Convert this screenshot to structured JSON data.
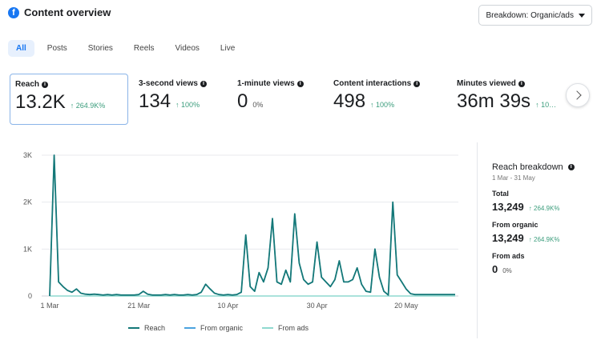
{
  "header": {
    "title": "Content overview",
    "logo_icon": "facebook-icon"
  },
  "breakdown_select": {
    "label": "Breakdown: Organic/ads"
  },
  "tabs": [
    {
      "label": "All",
      "active": true
    },
    {
      "label": "Posts"
    },
    {
      "label": "Stories"
    },
    {
      "label": "Reels"
    },
    {
      "label": "Videos"
    },
    {
      "label": "Live"
    }
  ],
  "metrics": [
    {
      "label": "Reach",
      "value": "13.2K",
      "delta": "↑ 264.9K%"
    },
    {
      "label": "3-second views",
      "value": "134",
      "delta": "↑ 100%"
    },
    {
      "label": "1-minute views",
      "value": "0",
      "delta": "0%"
    },
    {
      "label": "Content interactions",
      "value": "498",
      "delta": "↑ 100%"
    },
    {
      "label": "Minutes viewed",
      "value": "36m 39s",
      "delta": "↑ 10…"
    }
  ],
  "chart_data": {
    "type": "line",
    "x": [
      "1 Mar",
      "2 Mar",
      "3 Mar",
      "4 Mar",
      "5 Mar",
      "6 Mar",
      "7 Mar",
      "8 Mar",
      "9 Mar",
      "10 Mar",
      "11 Mar",
      "12 Mar",
      "13 Mar",
      "14 Mar",
      "15 Mar",
      "16 Mar",
      "17 Mar",
      "18 Mar",
      "19 Mar",
      "20 Mar",
      "21 Mar",
      "22 Mar",
      "23 Mar",
      "24 Mar",
      "25 Mar",
      "26 Mar",
      "27 Mar",
      "28 Mar",
      "29 Mar",
      "30 Mar",
      "31 Mar",
      "1 Apr",
      "2 Apr",
      "3 Apr",
      "4 Apr",
      "5 Apr",
      "6 Apr",
      "7 Apr",
      "8 Apr",
      "9 Apr",
      "10 Apr",
      "11 Apr",
      "12 Apr",
      "13 Apr",
      "14 Apr",
      "15 Apr",
      "16 Apr",
      "17 Apr",
      "18 Apr",
      "19 Apr",
      "20 Apr",
      "21 Apr",
      "22 Apr",
      "23 Apr",
      "24 Apr",
      "25 Apr",
      "26 Apr",
      "27 Apr",
      "28 Apr",
      "29 Apr",
      "30 Apr",
      "1 May",
      "2 May",
      "3 May",
      "4 May",
      "5 May",
      "6 May",
      "7 May",
      "8 May",
      "9 May",
      "10 May",
      "11 May",
      "12 May",
      "13 May",
      "14 May",
      "15 May",
      "16 May",
      "17 May",
      "18 May",
      "19 May",
      "20 May",
      "21 May",
      "22 May",
      "23 May",
      "24 May",
      "25 May",
      "26 May",
      "27 May",
      "28 May",
      "29 May",
      "30 May",
      "31 May"
    ],
    "series": [
      {
        "name": "Reach",
        "values": [
          0,
          3000,
          300,
          200,
          120,
          80,
          150,
          60,
          40,
          30,
          40,
          30,
          20,
          30,
          20,
          30,
          20,
          20,
          20,
          20,
          30,
          100,
          40,
          20,
          20,
          20,
          30,
          20,
          30,
          20,
          20,
          30,
          20,
          30,
          80,
          250,
          150,
          60,
          30,
          20,
          30,
          20,
          30,
          80,
          1300,
          200,
          100,
          500,
          300,
          600,
          1650,
          300,
          250,
          550,
          300,
          1750,
          700,
          350,
          250,
          300,
          1150,
          400,
          300,
          200,
          350,
          750,
          300,
          300,
          350,
          600,
          250,
          100,
          80,
          1000,
          400,
          100,
          20,
          2000,
          450,
          300,
          150,
          50,
          30,
          30,
          30,
          30,
          30,
          30,
          30,
          30,
          30,
          30
        ],
        "color": "#147878"
      },
      {
        "name": "From organic",
        "values": [
          0,
          3000,
          300,
          200,
          120,
          80,
          150,
          60,
          40,
          30,
          40,
          30,
          20,
          30,
          20,
          30,
          20,
          20,
          20,
          20,
          30,
          100,
          40,
          20,
          20,
          20,
          30,
          20,
          30,
          20,
          20,
          30,
          20,
          30,
          80,
          250,
          150,
          60,
          30,
          20,
          30,
          20,
          30,
          80,
          1300,
          200,
          100,
          500,
          300,
          600,
          1650,
          300,
          250,
          550,
          300,
          1750,
          700,
          350,
          250,
          300,
          1150,
          400,
          300,
          200,
          350,
          750,
          300,
          300,
          350,
          600,
          250,
          100,
          80,
          1000,
          400,
          100,
          20,
          2000,
          450,
          300,
          150,
          50,
          30,
          30,
          30,
          30,
          30,
          30,
          30,
          30,
          30,
          30
        ],
        "color": "#4aa3df"
      },
      {
        "name": "From ads",
        "values": [
          0,
          0,
          0,
          0,
          0,
          0,
          0,
          0,
          0,
          0,
          0,
          0,
          0,
          0,
          0,
          0,
          0,
          0,
          0,
          0,
          0,
          0,
          0,
          0,
          0,
          0,
          0,
          0,
          0,
          0,
          0,
          0,
          0,
          0,
          0,
          0,
          0,
          0,
          0,
          0,
          0,
          0,
          0,
          0,
          0,
          0,
          0,
          0,
          0,
          0,
          0,
          0,
          0,
          0,
          0,
          0,
          0,
          0,
          0,
          0,
          0,
          0,
          0,
          0,
          0,
          0,
          0,
          0,
          0,
          0,
          0,
          0,
          0,
          0,
          0,
          0,
          0,
          0,
          0,
          0,
          0,
          0,
          0,
          0,
          0,
          0,
          0,
          0,
          0,
          0,
          0,
          0
        ],
        "color": "#8fd9cf"
      }
    ],
    "xticks": [
      "1 Mar",
      "21 Mar",
      "10 Apr",
      "30 Apr",
      "20 May"
    ],
    "yticks": [
      "0",
      "1K",
      "2K",
      "3K"
    ],
    "ylim": [
      0,
      3000
    ],
    "legend": "bottom",
    "grid": true
  },
  "reach_breakdown": {
    "title": "Reach breakdown",
    "date_range": "1 Mar - 31 May",
    "items": [
      {
        "label": "Total",
        "value": "13,249",
        "delta": "↑ 264.9K%"
      },
      {
        "label": "From organic",
        "value": "13,249",
        "delta": "↑ 264.9K%"
      },
      {
        "label": "From ads",
        "value": "0",
        "delta": "0%"
      }
    ]
  }
}
